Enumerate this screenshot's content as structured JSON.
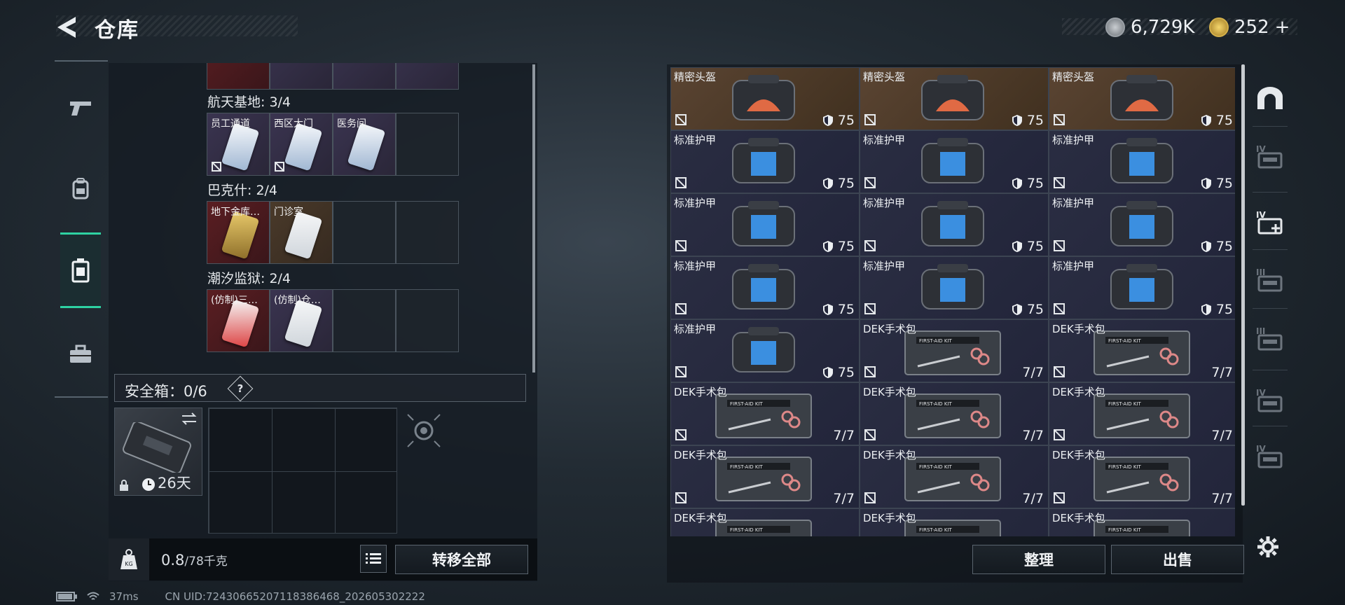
{
  "header": {
    "title": "仓库",
    "currency_silver": "6,729K",
    "currency_gold": "252",
    "add_label": "+"
  },
  "categories": [
    {
      "icon": "pistol-icon",
      "active": false
    },
    {
      "icon": "backpack-icon",
      "active": false
    },
    {
      "icon": "keycard-case-icon",
      "active": true
    },
    {
      "icon": "toolbox-icon",
      "active": false
    }
  ],
  "key_sections": [
    {
      "title": "航天基地: 3/4",
      "slots": [
        {
          "name": "员工通道",
          "tone": "purple",
          "card": "blue",
          "unbound": true
        },
        {
          "name": "西区大门",
          "tone": "purple",
          "card": "blue",
          "unbound": true
        },
        {
          "name": "医务间",
          "tone": "purple",
          "card": "blue",
          "unbound": false
        },
        {
          "name": "",
          "tone": "",
          "card": "",
          "unbound": false
        }
      ]
    },
    {
      "title": "巴克什: 2/4",
      "slots": [
        {
          "name": "地下金库…",
          "tone": "red",
          "card": "gold",
          "unbound": false
        },
        {
          "name": "门诊室",
          "tone": "gold",
          "card": "white",
          "unbound": false
        },
        {
          "name": "",
          "tone": "",
          "card": "",
          "unbound": false
        },
        {
          "name": "",
          "tone": "",
          "card": "",
          "unbound": false
        }
      ]
    },
    {
      "title": "潮汐监狱: 2/4",
      "slots": [
        {
          "name": "(仿制)三…",
          "tone": "red",
          "card": "red",
          "unbound": false
        },
        {
          "name": "(仿制)仓…",
          "tone": "purple",
          "card": "white",
          "unbound": false
        },
        {
          "name": "",
          "tone": "",
          "card": "",
          "unbound": false
        },
        {
          "name": "",
          "tone": "",
          "card": "",
          "unbound": false
        }
      ]
    }
  ],
  "safe_box": {
    "label": "安全箱：0/6",
    "help": "?",
    "duration": "26天"
  },
  "footer": {
    "weight_current": "0.8",
    "weight_max": "/78千克",
    "transfer_all": "转移全部"
  },
  "stash": {
    "items": [
      {
        "name": "精密头盔",
        "kind": "helmet",
        "value": "75",
        "tone": "brown"
      },
      {
        "name": "精密头盔",
        "kind": "helmet",
        "value": "75",
        "tone": "brown"
      },
      {
        "name": "精密头盔",
        "kind": "helmet",
        "value": "75",
        "tone": "brown"
      },
      {
        "name": "标准护甲",
        "kind": "armor",
        "value": "75",
        "tone": "purple"
      },
      {
        "name": "标准护甲",
        "kind": "armor",
        "value": "75",
        "tone": "purple"
      },
      {
        "name": "标准护甲",
        "kind": "armor",
        "value": "75",
        "tone": "purple"
      },
      {
        "name": "标准护甲",
        "kind": "armor",
        "value": "75",
        "tone": "purple"
      },
      {
        "name": "标准护甲",
        "kind": "armor",
        "value": "75",
        "tone": "purple"
      },
      {
        "name": "标准护甲",
        "kind": "armor",
        "value": "75",
        "tone": "purple"
      },
      {
        "name": "标准护甲",
        "kind": "armor",
        "value": "75",
        "tone": "purple"
      },
      {
        "name": "标准护甲",
        "kind": "armor",
        "value": "75",
        "tone": "purple"
      },
      {
        "name": "标准护甲",
        "kind": "armor",
        "value": "75",
        "tone": "purple"
      },
      {
        "name": "标准护甲",
        "kind": "armor",
        "value": "75",
        "tone": "purple"
      },
      {
        "name": "DEK手术包",
        "kind": "kit",
        "value": "7/7",
        "tone": "purple"
      },
      {
        "name": "DEK手术包",
        "kind": "kit",
        "value": "7/7",
        "tone": "purple"
      },
      {
        "name": "DEK手术包",
        "kind": "kit",
        "value": "7/7",
        "tone": "purple"
      },
      {
        "name": "DEK手术包",
        "kind": "kit",
        "value": "7/7",
        "tone": "purple"
      },
      {
        "name": "DEK手术包",
        "kind": "kit",
        "value": "7/7",
        "tone": "purple"
      },
      {
        "name": "DEK手术包",
        "kind": "kit",
        "value": "7/7",
        "tone": "purple"
      },
      {
        "name": "DEK手术包",
        "kind": "kit",
        "value": "7/7",
        "tone": "purple"
      },
      {
        "name": "DEK手术包",
        "kind": "kit",
        "value": "7/7",
        "tone": "purple"
      },
      {
        "name": "DEK手术包",
        "kind": "kit",
        "value": "",
        "tone": "purple"
      },
      {
        "name": "DEK手术包",
        "kind": "kit",
        "value": "",
        "tone": "purple"
      },
      {
        "name": "DEK手术包",
        "kind": "kit",
        "value": "",
        "tone": "purple"
      }
    ],
    "kit_label": "FIRST-AID KIT",
    "sort_button": "整理",
    "sell_button": "出售"
  },
  "right_sidebar": [
    {
      "icon": "home-arch-icon",
      "tier": ""
    },
    {
      "icon": "weapon-case-iv-icon",
      "tier": "IV"
    },
    {
      "icon": "medkit-case-iv-icon",
      "tier": "IV"
    },
    {
      "icon": "weapon-case-iii-icon",
      "tier": "III"
    },
    {
      "icon": "tool-case-iii-icon",
      "tier": "III"
    },
    {
      "icon": "tool-case-iv-icon",
      "tier": "IV"
    },
    {
      "icon": "misc-case-iv-icon",
      "tier": "IV"
    }
  ],
  "status": {
    "ping": "37ms",
    "uid": "CN UID:7243066520711838646​8_202605302222"
  },
  "colors": {
    "accent": "#2ed2a2",
    "brown": "#5a4432",
    "purple": "#2a2d42"
  }
}
